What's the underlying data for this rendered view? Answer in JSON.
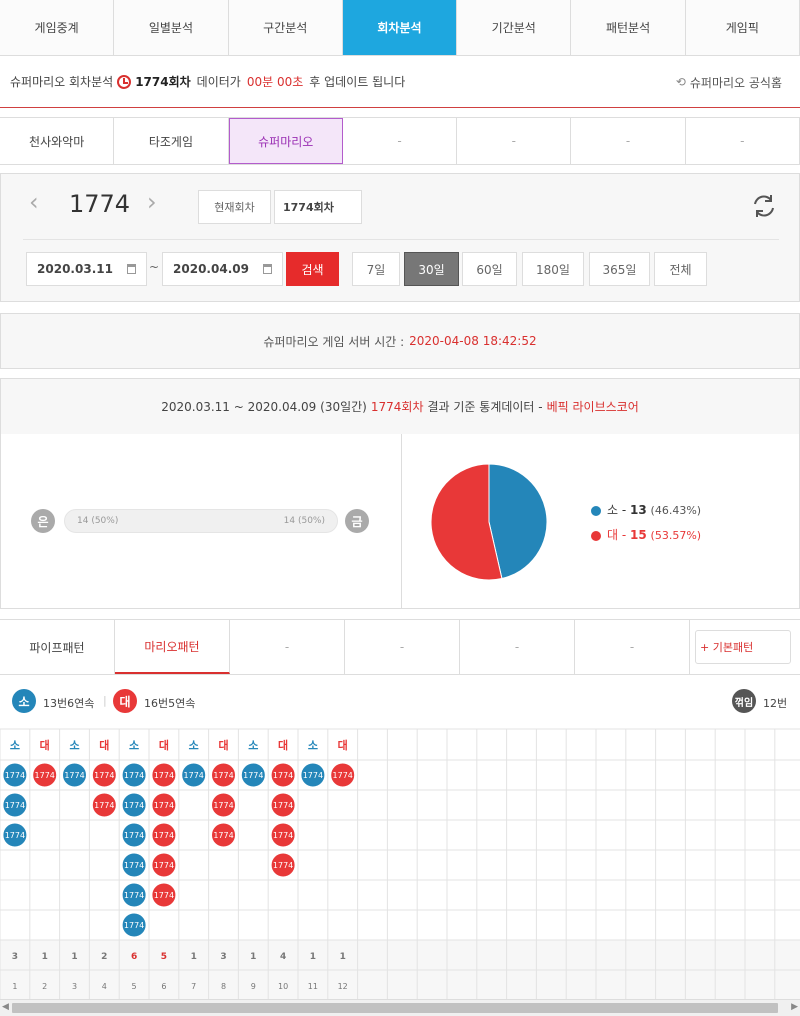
{
  "main_tabs": [
    "게임중계",
    "일별분석",
    "구간분석",
    "회차분석",
    "기간분석",
    "패턴분석",
    "게임픽"
  ],
  "active_main_tab": "회차분석",
  "info": {
    "prefix": "슈퍼마리오 회차분석",
    "round": "1774회차",
    "mid": "데이터가",
    "time": "00분 00초",
    "suffix": "후 업데이트 됩니다",
    "official": "슈퍼마리오 공식홈"
  },
  "game_tabs": [
    "천사와악마",
    "타조게임",
    "슈퍼마리오",
    "-",
    "-",
    "-",
    "-"
  ],
  "active_game_tab": "슈퍼마리오",
  "round_nav": {
    "prev": "‹",
    "round": "1774",
    "next": "›",
    "current_btn": "현재회차",
    "round_value": "1774회차"
  },
  "date_filter": {
    "start": "2020.03.11",
    "sep": "~",
    "end": "2020.04.09",
    "search": "검색",
    "periods": [
      "7일",
      "30일",
      "60일",
      "180일",
      "365일",
      "전체"
    ],
    "active_period": "30일"
  },
  "server_time": {
    "label": "슈퍼마리오 게임 서버 시간 :",
    "value": "2020-04-08 18:42:52"
  },
  "stats_header": {
    "range": "2020.03.11 ~ 2020.04.09 (30일간)",
    "round": "1774회차",
    "mid": "결과 기준 통계데이터 -",
    "source": "베픽 라이브스코어"
  },
  "oddeven": {
    "left_label": "은",
    "right_label": "금",
    "left_value": "14 (50%)",
    "right_value": "14 (50%)",
    "left_pct": 50
  },
  "pie": {
    "small_label": "소",
    "small_count": "13",
    "small_pct": "(46.43%)",
    "big_label": "대",
    "big_count": "15",
    "big_pct": "(53.57%)",
    "colors": {
      "small": "#2486b9",
      "big": "#e83838"
    }
  },
  "pattern_tabs": [
    "파이프패턴",
    "마리오패턴",
    "-",
    "-",
    "-",
    "-"
  ],
  "active_pattern_tab": "마리오패턴",
  "basic_pattern_btn": "+ 기본패턴",
  "summary": {
    "small_badge": "소",
    "small_text": "13번6연속",
    "big_badge": "대",
    "big_text": "16번5연속",
    "switch_badge": "꺾임",
    "switch_text": "12번"
  },
  "chart_data": {
    "type": "table",
    "columns": [
      "소",
      "대",
      "소",
      "대",
      "소",
      "대",
      "소",
      "대",
      "소",
      "대",
      "소",
      "대"
    ],
    "column_runs": [
      3,
      1,
      1,
      2,
      6,
      5,
      1,
      3,
      1,
      4,
      1,
      1
    ],
    "column_numbers": [
      1,
      2,
      3,
      4,
      5,
      6,
      7,
      8,
      9,
      10,
      11,
      12
    ],
    "cell_label": "1774",
    "colors": {
      "소": "#2486b9",
      "대": "#e83838"
    }
  }
}
